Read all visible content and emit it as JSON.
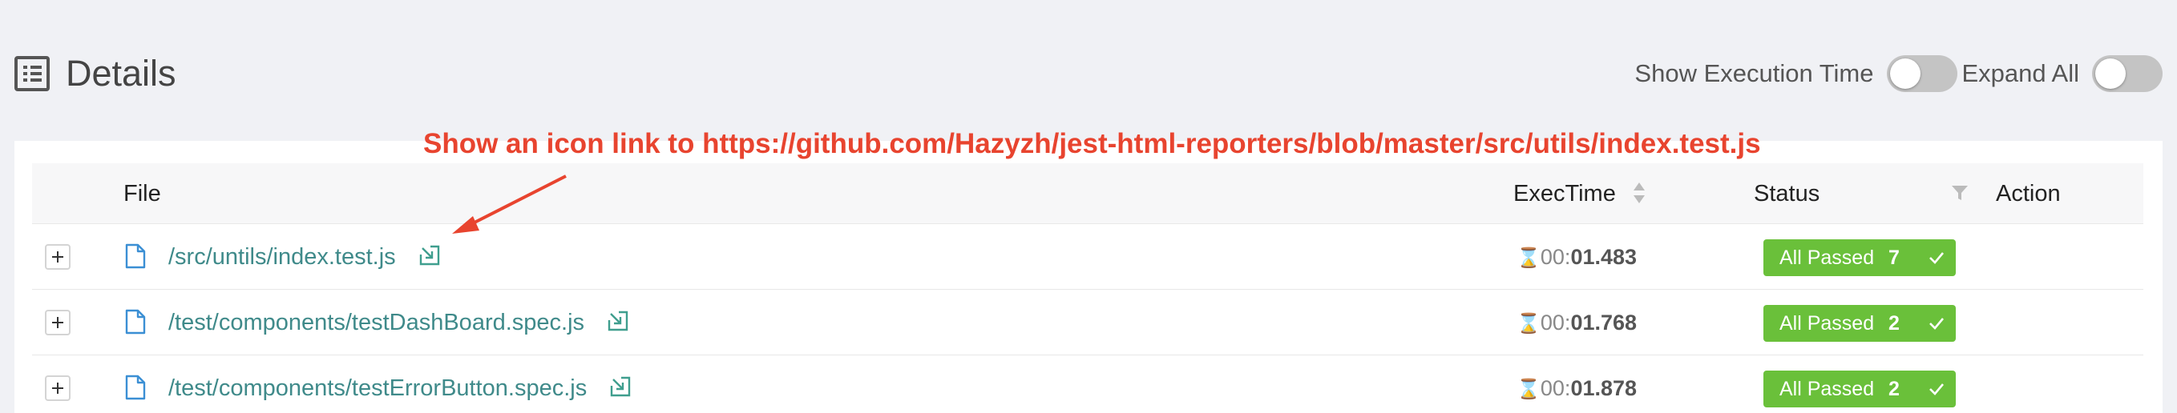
{
  "header": {
    "title": "Details",
    "show_exec_label": "Show Execution Time",
    "expand_all_label": "Expand All"
  },
  "annotation": "Show an icon link to https://github.com/Hazyzh/jest-html-reporters/blob/master/src/utils/index.test.js",
  "table": {
    "columns": {
      "file": "File",
      "exectime": "ExecTime",
      "status": "Status",
      "action": "Action"
    },
    "rows": [
      {
        "file": "/src/untils/index.test.js",
        "time_prefix": "00:",
        "time_value": "01.483",
        "status": "All Passed",
        "count": "7"
      },
      {
        "file": "/test/components/testDashBoard.spec.js",
        "time_prefix": "00:",
        "time_value": "01.768",
        "status": "All Passed",
        "count": "2"
      },
      {
        "file": "/test/components/testErrorButton.spec.js",
        "time_prefix": "00:",
        "time_value": "01.878",
        "status": "All Passed",
        "count": "2"
      }
    ]
  },
  "colors": {
    "passed": "#6ac03a",
    "link": "#3f8a8a",
    "annotation": "#e8442f"
  },
  "icons": {
    "title": "list-icon",
    "file": "file-icon",
    "link": "external-link-icon",
    "hourglass": "hourglass-icon",
    "check": "check-icon",
    "expand": "plus-icon",
    "sort": "sort-icon",
    "filter": "filter-icon"
  }
}
